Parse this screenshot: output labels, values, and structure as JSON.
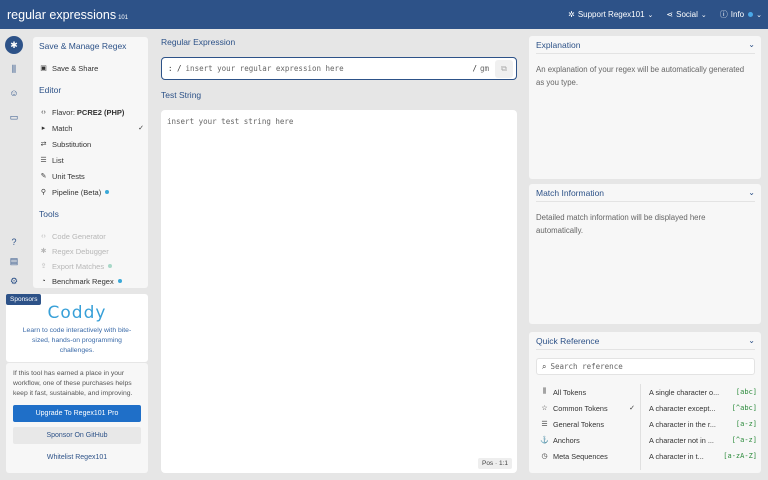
{
  "header": {
    "brand_main": "regular expressions",
    "brand_sub": "101",
    "nav": [
      {
        "label": "Support Regex101",
        "icon": "gear-icon"
      },
      {
        "label": "Social",
        "icon": "share-icon"
      },
      {
        "label": "Info",
        "icon": "info-icon"
      }
    ]
  },
  "iconbar": [
    "asterisk-icon",
    "library-icon",
    "user-icon",
    "keyboard-icon",
    "help-icon",
    "message-icon",
    "settings-icon"
  ],
  "left": {
    "save_section": "Save & Manage Regex",
    "save_share": "Save & Share",
    "editor_section": "Editor",
    "flavor_label": "Flavor:",
    "flavor_value": "PCRE2 (PHP)",
    "items": [
      "Match",
      "Substitution",
      "List",
      "Unit Tests",
      "Pipeline (Beta)"
    ],
    "tools_section": "Tools",
    "tools": [
      "Code Generator",
      "Regex Debugger",
      "Export Matches",
      "Benchmark Regex"
    ]
  },
  "sponsors": {
    "tag": "Sponsors",
    "logo": "Coddy",
    "text": "Learn to code interactively with bite-sized, hands-on programming challenges.",
    "support_text": "If this tool has earned a place in your workflow, one of these purchases helps keep it fast, sustainable, and improving.",
    "btn_pro": "Upgrade To Regex101 Pro",
    "btn_github": "Sponsor On GitHub",
    "btn_whitelist": "Whitelist Regex101"
  },
  "main": {
    "regex_label": "Regular Expression",
    "regex_prefix": ": /",
    "regex_placeholder": "insert your regular expression here",
    "regex_suffix": "/",
    "flags": "gm",
    "test_label": "Test String",
    "test_placeholder": "insert your test string here",
    "pos": "Pos · 1:1"
  },
  "right": {
    "explanation_title": "Explanation",
    "explanation_text": "An explanation of your regex will be automatically generated as you type.",
    "match_title": "Match Information",
    "match_text": "Detailed match information will be displayed here automatically.",
    "qr_title": "Quick Reference",
    "qr_placeholder": "Search reference",
    "categories": [
      "All Tokens",
      "Common Tokens",
      "General Tokens",
      "Anchors",
      "Meta Sequences"
    ],
    "rows": [
      {
        "desc": "A single character o...",
        "code": "[abc]"
      },
      {
        "desc": "A character except...",
        "code": "[^abc]"
      },
      {
        "desc": "A character in the r...",
        "code": "[a-z]"
      },
      {
        "desc": "A character not in ...",
        "code": "[^a-z]"
      },
      {
        "desc": "A character in t...",
        "code": "[a-zA-Z]"
      }
    ]
  }
}
